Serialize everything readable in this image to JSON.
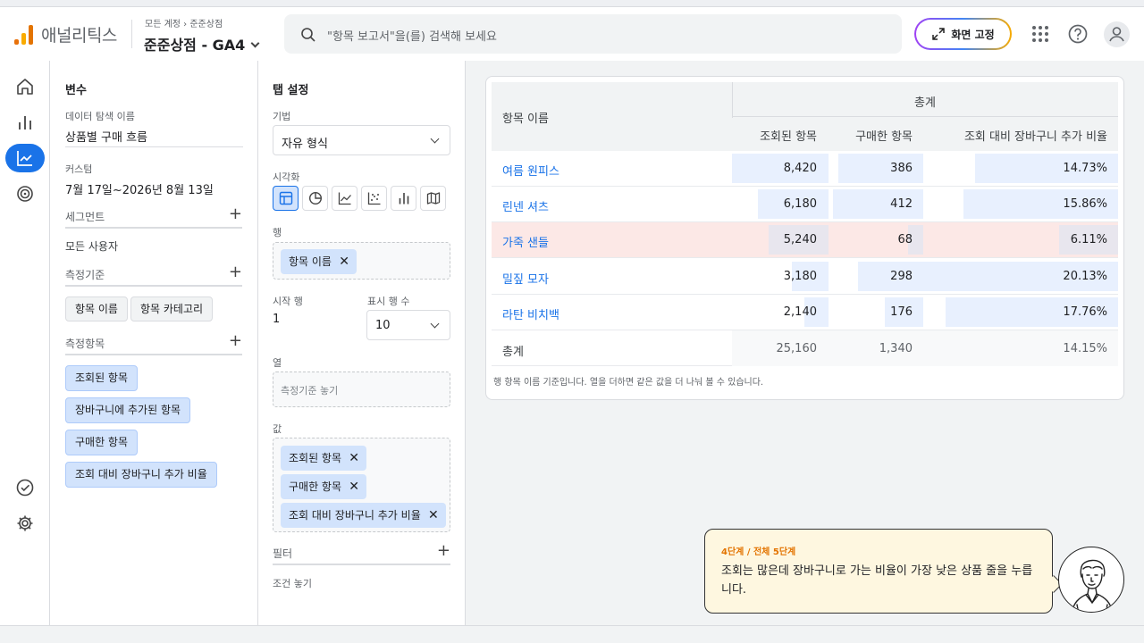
{
  "header": {
    "brand": "애널리틱스",
    "crumb_account": "모든 계정",
    "crumb_sep": "›",
    "crumb_property": "준준상점",
    "property": "준준상점 - GA4",
    "search_placeholder": "\"항목 보고서\"을(를) 검색해 보세요",
    "pin_label": "화면 고정",
    "icons": [
      "apps-icon",
      "help-icon",
      "account-icon"
    ]
  },
  "rail": {
    "items": [
      "home-icon",
      "reports-icon",
      "explore-icon",
      "advertising-icon"
    ],
    "bottom": [
      "check-icon",
      "settings-icon"
    ],
    "active": "explore-icon"
  },
  "variables": {
    "title": "변수",
    "exploration_label": "데이터 탐색 이름",
    "exploration_name": "상품별 구매 흐름",
    "date_label": "커스텀",
    "date_range": "7월 17일~2026년 8월 13일",
    "segments_title": "세그먼트",
    "segment_item": "모든 사용자",
    "dimensions_title": "측정기준",
    "dimensions": [
      "항목 이름",
      "항목 카테고리"
    ],
    "metrics_title": "측정항목",
    "metrics": [
      "조회된 항목",
      "장바구니에 추가된 항목",
      "구매한 항목",
      "조회 대비 장바구니 추가 비율"
    ]
  },
  "tab_settings": {
    "title": "탭 설정",
    "technique_label": "기법",
    "technique_value": "자유 형식",
    "viz_label": "시각화",
    "rows_label": "행",
    "rows_chip": "항목 이름",
    "start_row_label": "시작 행",
    "start_row_value": "1",
    "show_rows_label": "표시 행 수",
    "show_rows_value": "10",
    "columns_label": "열",
    "columns_placeholder": "측정기준 놓기",
    "values_label": "값",
    "values": [
      "조회된 항목",
      "구매한 항목",
      "조회 대비 장바구니 추가 비율"
    ],
    "filters_label": "필터",
    "filters_placeholder": "조건 놓기"
  },
  "table": {
    "dim_header": "항목 이름",
    "group_header": "총계",
    "col_headers": [
      "조회된 항목",
      "구매한 항목",
      "조회 대비 장바구니 추가 비율"
    ],
    "rows": [
      {
        "name": "여름 원피스",
        "views": "8,420",
        "purchases": "386",
        "rate": "14.73%",
        "views_frac": 1.0,
        "purch_frac": 0.937,
        "rate_frac": 0.73
      },
      {
        "name": "린넨 셔츠",
        "views": "6,180",
        "purchases": "412",
        "rate": "15.86%",
        "views_frac": 0.734,
        "purch_frac": 1.0,
        "rate_frac": 0.79
      },
      {
        "name": "가죽 샌들",
        "views": "5,240",
        "purchases": "68",
        "rate": "6.11%",
        "views_frac": 0.622,
        "purch_frac": 0.165,
        "rate_frac": 0.3
      },
      {
        "name": "밀짚 모자",
        "views": "3,180",
        "purchases": "298",
        "rate": "20.13%",
        "views_frac": 0.378,
        "purch_frac": 0.723,
        "rate_frac": 1.0
      },
      {
        "name": "라탄 비치백",
        "views": "2,140",
        "purchases": "176",
        "rate": "17.76%",
        "views_frac": 0.254,
        "purch_frac": 0.427,
        "rate_frac": 0.88
      }
    ],
    "highlight_row": 2,
    "total": {
      "label": "총계",
      "views": "25,160",
      "purchases": "1,340",
      "rate": "14.15%"
    },
    "footnote": "행 항목 이름 기준입니다. 열을 더하면 같은 값을 더 나눠 볼 수 있습니다."
  },
  "tooltip": {
    "step": "4단계 / 전체 5단계",
    "message": "조회는 많은데 장바구니로 가는 비율이 가장 낮은 상품 줄을 누릅니다."
  },
  "colors": {
    "accent": "#1a73e8",
    "chip_blue": "#d2e3fc",
    "highlight_row": "#fce8e6",
    "tooltip_bg": "#fef7e0",
    "step_text": "#e37400"
  }
}
